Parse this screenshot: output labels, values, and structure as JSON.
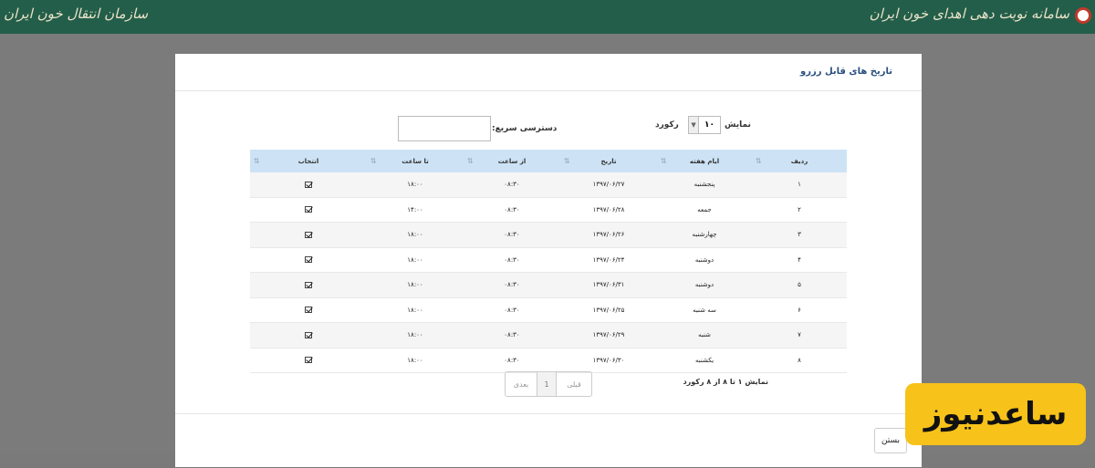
{
  "topbar": {
    "right_title": "سامانه نوبت دهی اهدای خون ایران",
    "left_title": "سازمان انتقال خون ایران"
  },
  "modal": {
    "title": "تاریخ های قابل رزرو",
    "show_label": "نمایش",
    "records_label": "رکورد",
    "page_size": "۱۰",
    "quick_search_label": "دسترسی سریع:",
    "quick_search_value": "",
    "columns": [
      "ردیف",
      "ایام هفته",
      "تاریخ",
      "از ساعت",
      "تا ساعت",
      "انتخاب"
    ],
    "rows": [
      {
        "index": "۱",
        "day": "پنجشنبه",
        "date": "۱۳۹۷/۰۶/۲۷",
        "from": "۰۸:۳۰",
        "to": "۱۸:۰۰"
      },
      {
        "index": "۲",
        "day": "جمعه",
        "date": "۱۳۹۷/۰۶/۲۸",
        "from": "۰۸:۳۰",
        "to": "۱۴:۰۰"
      },
      {
        "index": "۳",
        "day": "چهارشنبه",
        "date": "۱۳۹۷/۰۶/۲۶",
        "from": "۰۸:۳۰",
        "to": "۱۸:۰۰"
      },
      {
        "index": "۴",
        "day": "دوشنبه",
        "date": "۱۳۹۷/۰۶/۲۴",
        "from": "۰۸:۳۰",
        "to": "۱۸:۰۰"
      },
      {
        "index": "۵",
        "day": "دوشنبه",
        "date": "۱۳۹۷/۰۶/۳۱",
        "from": "۰۸:۳۰",
        "to": "۱۸:۰۰"
      },
      {
        "index": "۶",
        "day": "سه شنبه",
        "date": "۱۳۹۷/۰۶/۲۵",
        "from": "۰۸:۳۰",
        "to": "۱۸:۰۰"
      },
      {
        "index": "۷",
        "day": "شنبه",
        "date": "۱۳۹۷/۰۶/۲۹",
        "from": "۰۸:۳۰",
        "to": "۱۸:۰۰"
      },
      {
        "index": "۸",
        "day": "یکشنبه",
        "date": "۱۳۹۷/۰۶/۳۰",
        "from": "۰۸:۳۰",
        "to": "۱۸:۰۰"
      }
    ],
    "info": "نمایش ۱ تا ۸ از ۸ رکورد",
    "pager": {
      "prev": "قبلی",
      "page": "1",
      "next": "بعدی"
    },
    "close_label": "بستن"
  },
  "watermark": "ساعدنیوز",
  "colors": {
    "topbar": "#235e4a",
    "header_row": "#cde3f5",
    "title": "#2a4f7f",
    "watermark": "#f7c21a"
  }
}
